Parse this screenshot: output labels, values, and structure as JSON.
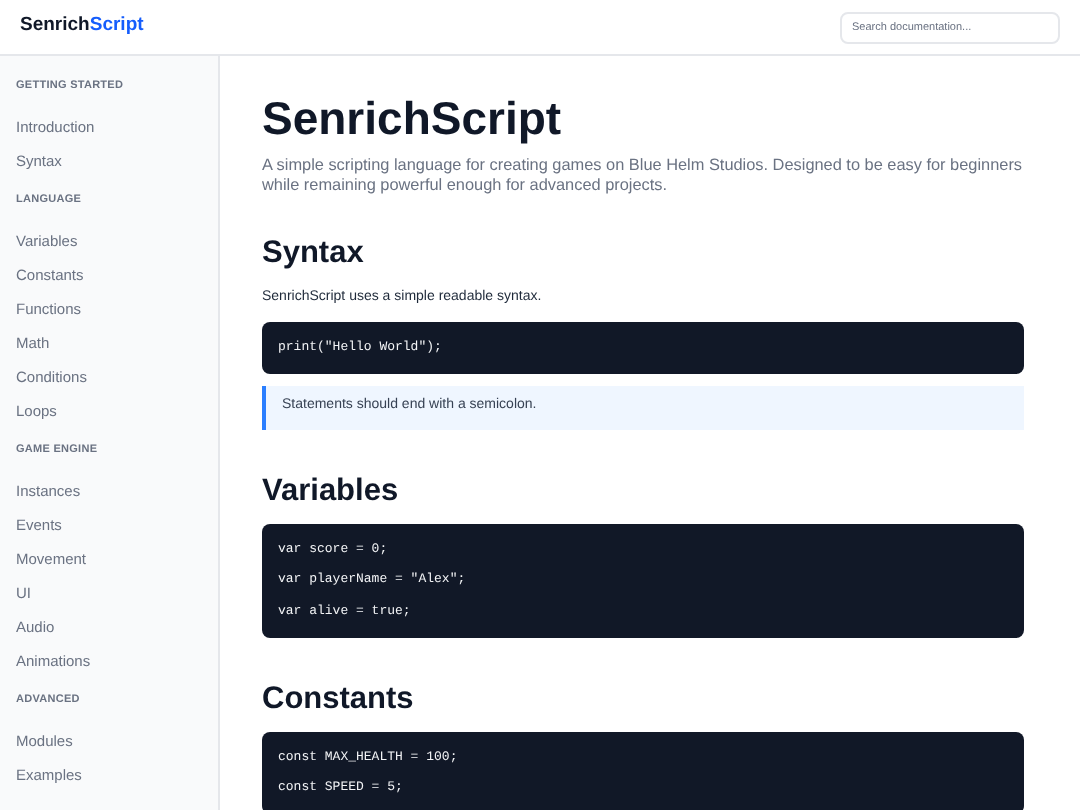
{
  "header": {
    "logo_parts": [
      {
        "text": "Senrich",
        "accent": false
      },
      {
        "text": "Script",
        "accent": true
      }
    ],
    "search": {
      "placeholder": "Search documentation..."
    }
  },
  "sidebar": {
    "sections": [
      {
        "heading": "GETTING STARTED",
        "items": [
          "Introduction",
          "Syntax"
        ]
      },
      {
        "heading": "LANGUAGE",
        "items": [
          "Variables",
          "Constants",
          "Functions",
          "Math",
          "Conditions",
          "Loops"
        ]
      },
      {
        "heading": "GAME ENGINE",
        "items": [
          "Instances",
          "Events",
          "Movement",
          "UI",
          "Audio",
          "Animations"
        ]
      },
      {
        "heading": "ADVANCED",
        "items": [
          "Modules",
          "Examples"
        ]
      }
    ]
  },
  "main": {
    "title": "SenrichScript",
    "intro": "A simple scripting language for creating games on Blue Helm Studios. Designed to be easy for beginners while remaining powerful enough for advanced projects.",
    "sections": [
      {
        "heading": "Syntax",
        "blocks": [
          {
            "kind": "paragraph",
            "text": "SenrichScript uses a simple readable syntax."
          },
          {
            "kind": "code",
            "lines": [
              "print(\"Hello World\");"
            ]
          },
          {
            "kind": "note",
            "text": "Statements should end with a semicolon."
          }
        ]
      },
      {
        "heading": "Variables",
        "blocks": [
          {
            "kind": "code",
            "lines": [
              "var score = 0;",
              "var playerName = \"Alex\";",
              "var alive = true;"
            ]
          }
        ]
      },
      {
        "heading": "Constants",
        "blocks": [
          {
            "kind": "code",
            "lines": [
              "const MAX_HEALTH = 100;",
              "const SPEED = 5;"
            ]
          }
        ]
      }
    ]
  }
}
